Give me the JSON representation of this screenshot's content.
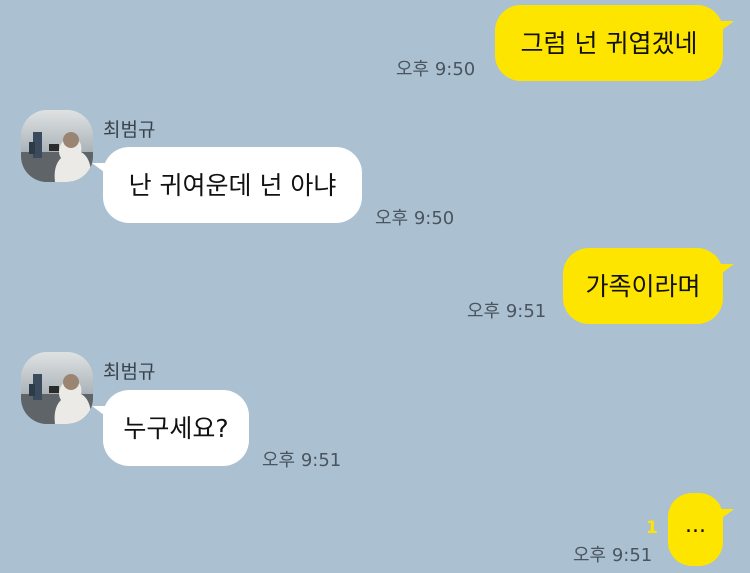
{
  "colors": {
    "background": "#abc1d1",
    "outgoing_bubble": "#fee500",
    "incoming_bubble": "#ffffff",
    "unread_count": "#fee500"
  },
  "messages": [
    {
      "direction": "out",
      "text": "그럼 넌 귀엽겠네",
      "time": "오후 9:50"
    },
    {
      "direction": "in",
      "sender": "최범규",
      "avatar": "profile-photo",
      "text": "난 귀여운데 넌 아냐",
      "time": "오후 9:50"
    },
    {
      "direction": "out",
      "text": "가족이라며",
      "time": "오후 9:51"
    },
    {
      "direction": "in",
      "sender": "최범규",
      "avatar": "profile-photo",
      "text": "누구세요?",
      "time": "오후 9:51"
    },
    {
      "direction": "out",
      "text": "...",
      "time": "오후 9:51",
      "unread": "1"
    }
  ]
}
